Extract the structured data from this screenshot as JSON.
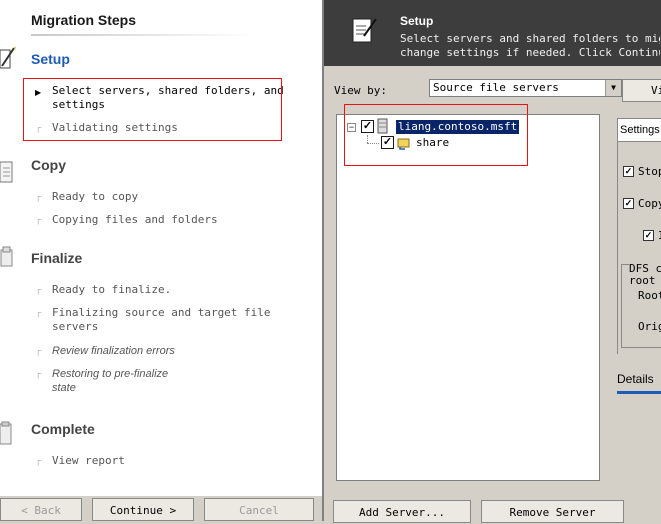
{
  "left": {
    "title": "Migration Steps",
    "sections": [
      {
        "title": "Setup",
        "steps": [
          "Select servers, shared folders, and settings",
          "Validating settings"
        ]
      },
      {
        "title": "Copy",
        "steps": [
          "Ready to copy",
          "Copying files and folders"
        ]
      },
      {
        "title": "Finalize",
        "steps": [
          "Ready to finalize.",
          "Finalizing source and target file servers",
          "Review finalization errors",
          "Restoring to pre-finalize state"
        ]
      },
      {
        "title": "Complete",
        "steps": [
          "View report"
        ]
      }
    ],
    "setup_step1_line1": "Select servers, shared folders, and",
    "setup_step1_line2": "settings",
    "finalize_step2_line1": "Finalizing source and target file",
    "finalize_step2_line2": "servers",
    "finalize_step4_line1": "Restoring to pre-finalize",
    "finalize_step4_line2": "state"
  },
  "buttons": {
    "back": "< Back",
    "continue": "Continue >",
    "cancel": "Cancel",
    "add_server": "Add Server...",
    "remove_server": "Remove Server",
    "view": "Vi"
  },
  "header": {
    "title": "Setup",
    "desc_line1": "Select servers and shared folders to migrate",
    "desc_line2": "change settings if needed. Click Continue to"
  },
  "viewby": {
    "label": "View by:",
    "selected": "Source file servers"
  },
  "tree": {
    "server": "liang.contoso.msft",
    "share": "share",
    "server_checked": true,
    "share_checked": true
  },
  "settings": {
    "tab": "Settings",
    "opt1": "Stop",
    "opt2": "Copy",
    "opt3": "I",
    "dfs_title": "DFS c",
    "dfs_root": "root",
    "root_label": "Root",
    "orig_label": "Orig",
    "details_tab": "Details"
  },
  "colors": {
    "accent": "#1c5cb5",
    "header_bg": "#3d3d3d",
    "selection": "#0a246a",
    "highlight_box": "#ee1111"
  }
}
